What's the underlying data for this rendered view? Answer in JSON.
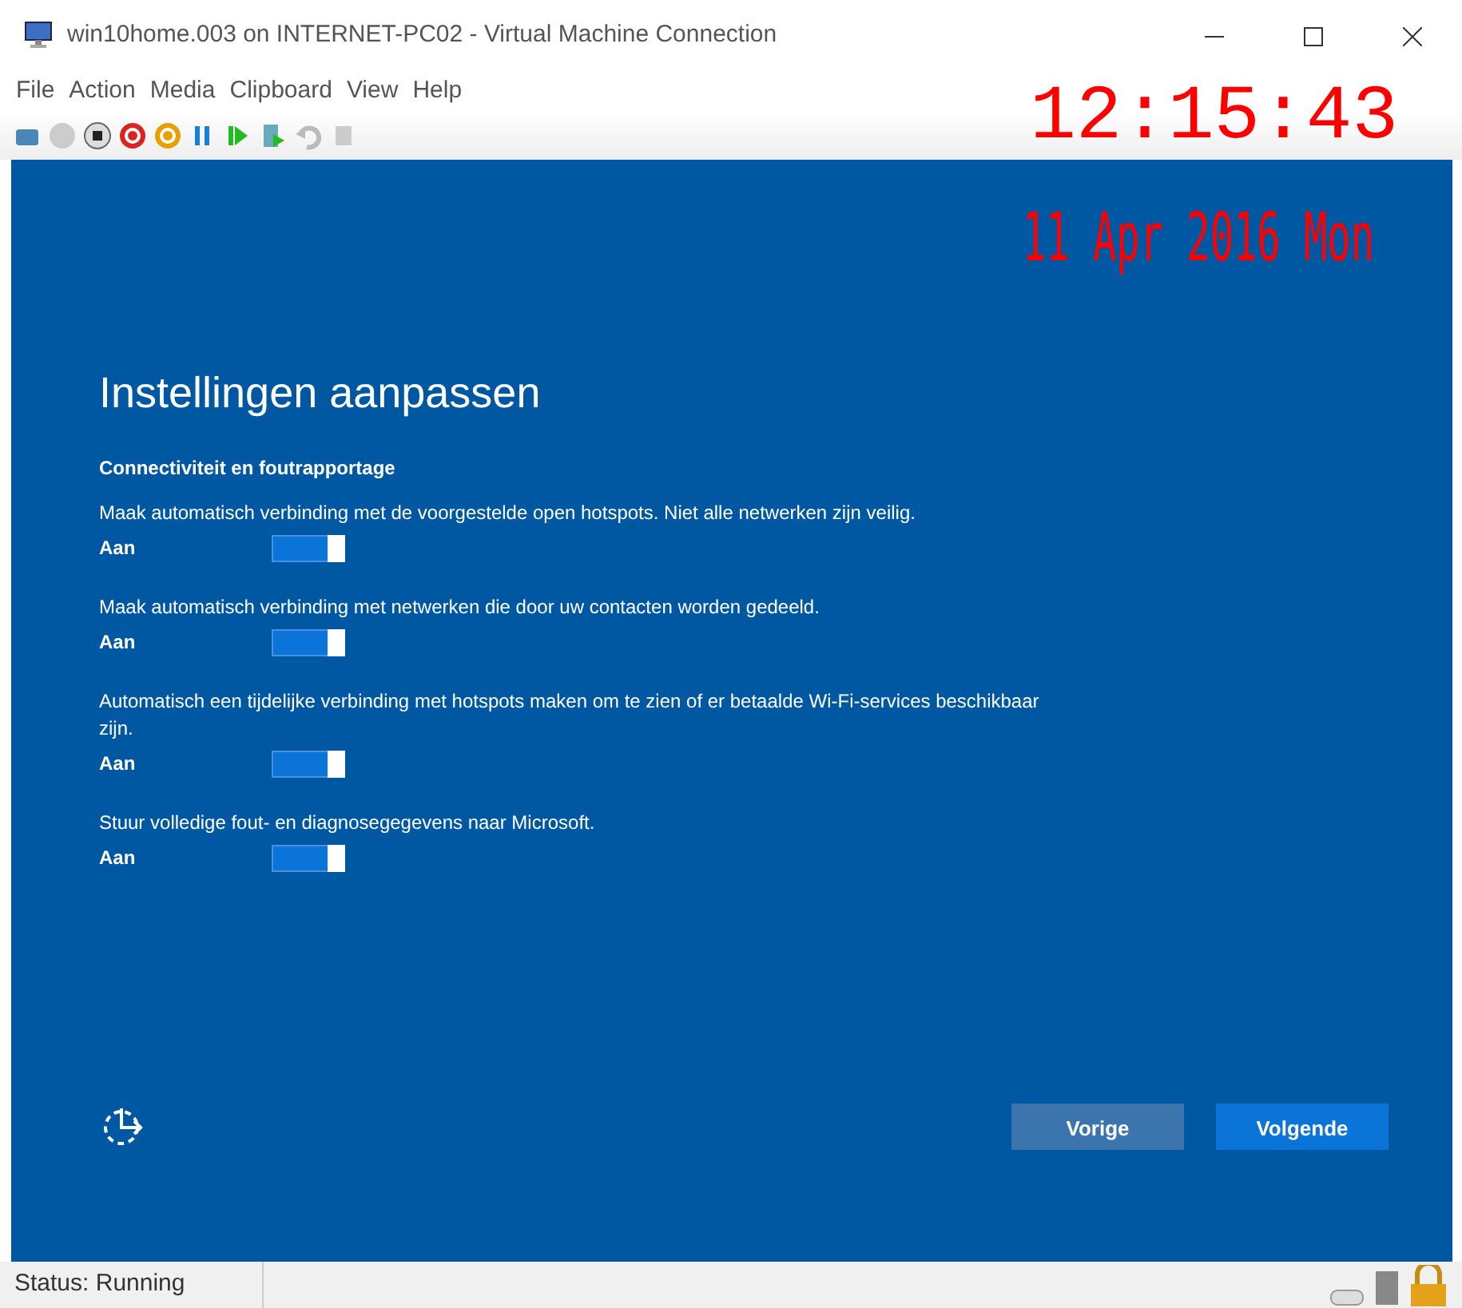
{
  "window": {
    "title": "win10home.003 on INTERNET-PC02 - Virtual Machine Connection"
  },
  "menu": [
    "File",
    "Action",
    "Media",
    "Clipboard",
    "View",
    "Help"
  ],
  "overlay": {
    "time": "12:15:43",
    "date": "11 Apr 2016 Mon"
  },
  "setup": {
    "heading": "Instellingen aanpassen",
    "section": "Connectiviteit en foutrapportage",
    "settings": [
      {
        "text": "Maak automatisch verbinding met de voorgestelde open hotspots. Niet alle netwerken zijn veilig.",
        "state_label": "Aan",
        "on": true
      },
      {
        "text": "Maak automatisch verbinding met netwerken die door uw contacten worden gedeeld.",
        "state_label": "Aan",
        "on": true
      },
      {
        "text": "Automatisch een tijdelijke verbinding met hotspots maken om te zien of er betaalde Wi-Fi-services beschikbaar zijn.",
        "state_label": "Aan",
        "on": true
      },
      {
        "text": "Stuur volledige fout- en diagnosegegevens naar Microsoft.",
        "state_label": "Aan",
        "on": true
      }
    ],
    "buttons": [
      {
        "label": "Vorige",
        "kind": "secondary"
      },
      {
        "label": "Volgende",
        "kind": "primary"
      }
    ]
  },
  "status_bar": {
    "status": "Status: Running"
  }
}
